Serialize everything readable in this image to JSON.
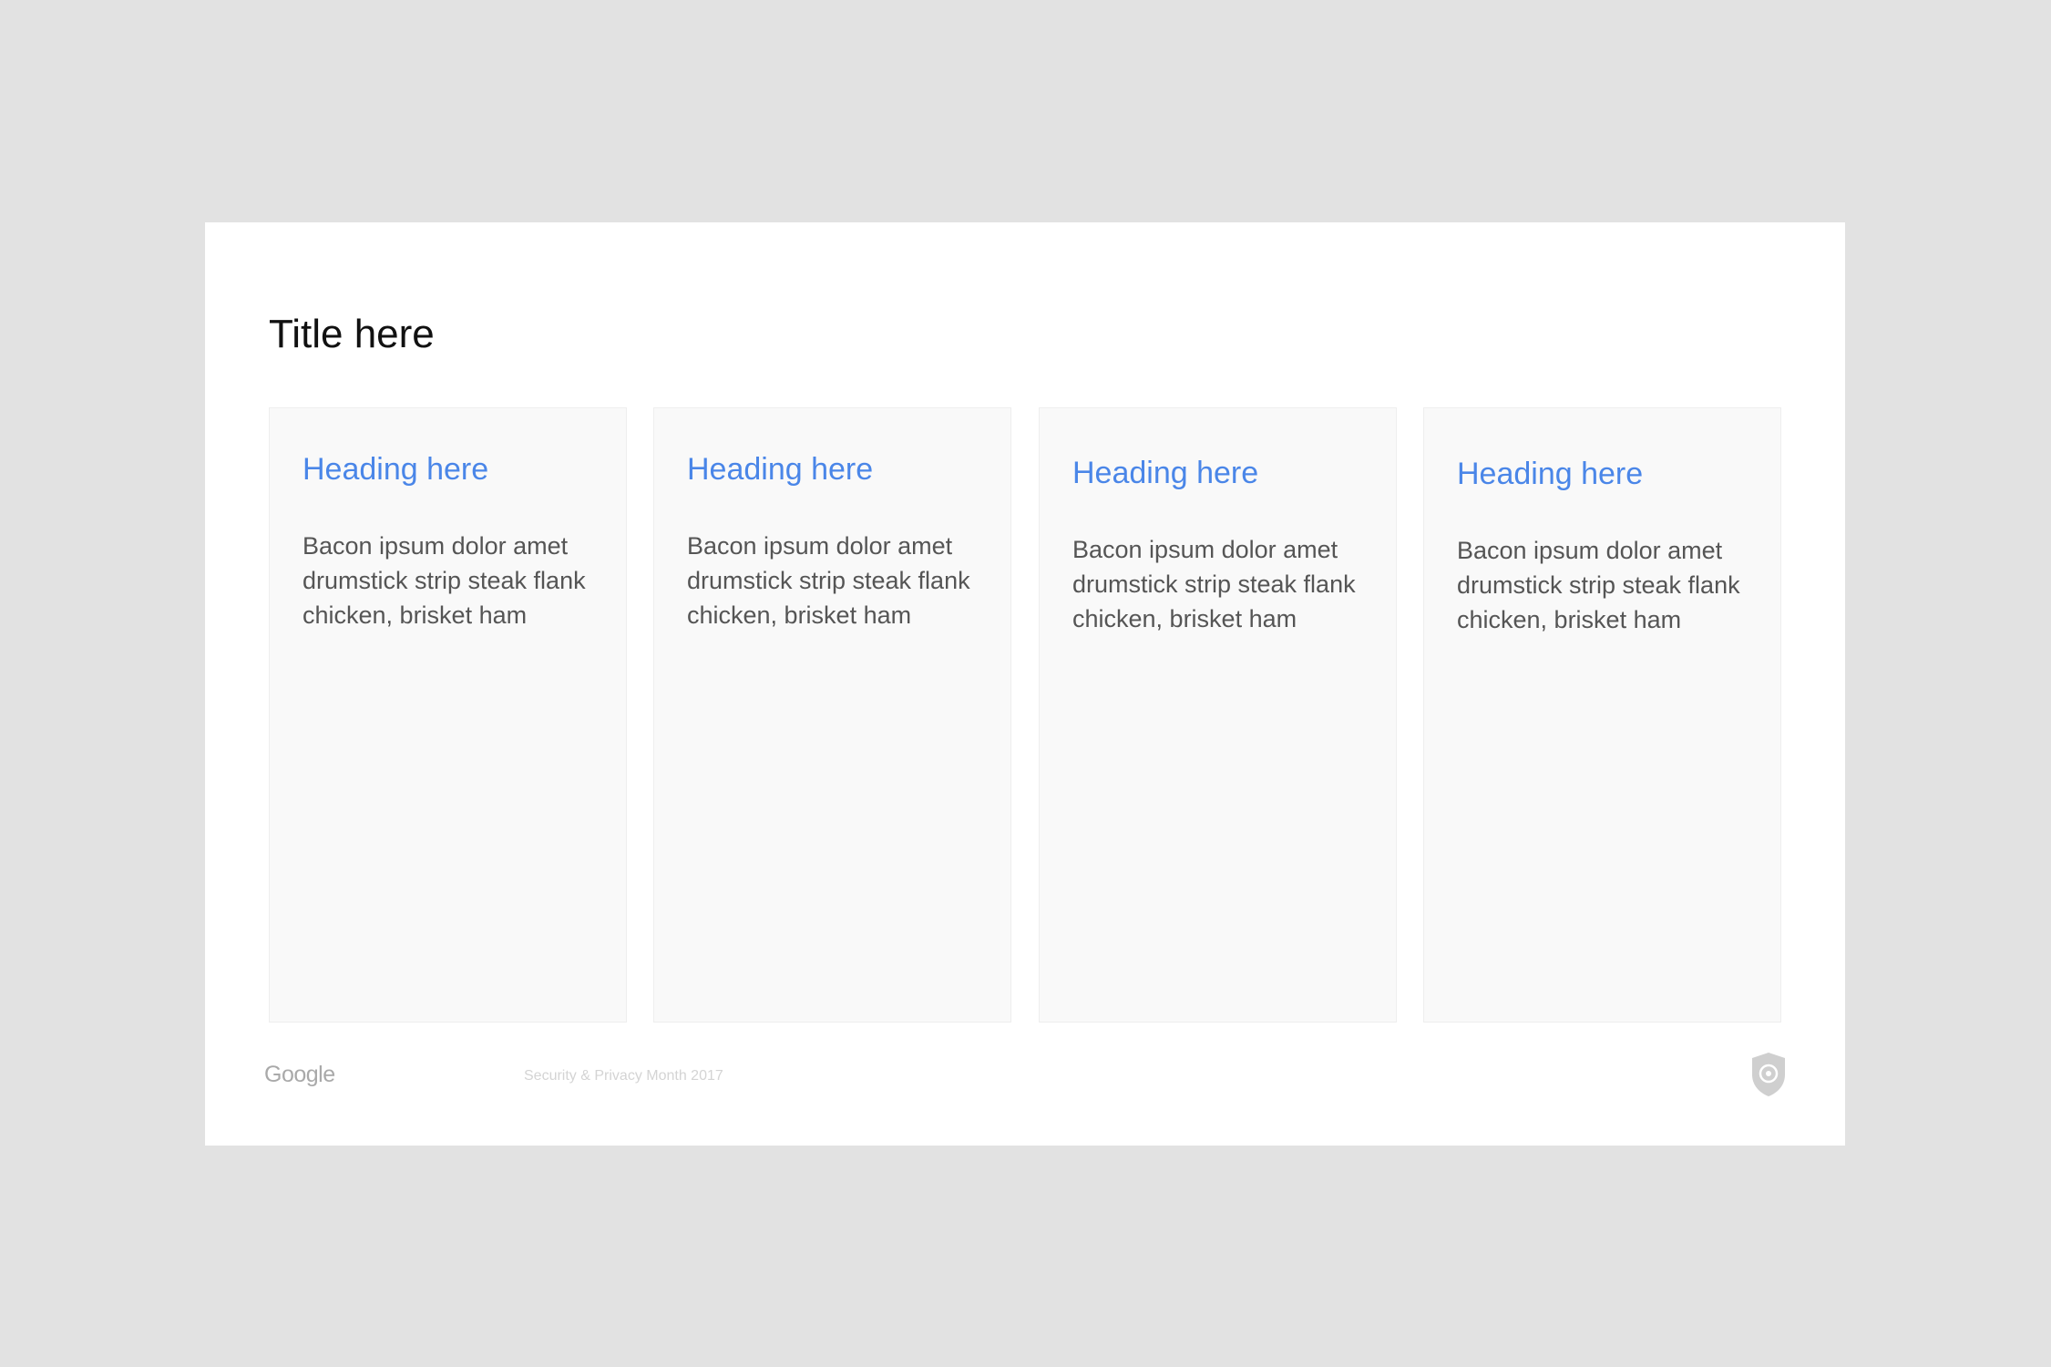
{
  "slide": {
    "title": "Title here",
    "cards": [
      {
        "heading": "Heading here",
        "body": "Bacon ipsum dolor amet drumstick strip steak flank chicken, brisket ham"
      },
      {
        "heading": "Heading here",
        "body": "Bacon ipsum dolor amet drumstick strip steak flank chicken, brisket ham"
      },
      {
        "heading": "Heading here",
        "body": "Bacon ipsum dolor amet drumstick strip steak flank chicken, brisket ham"
      },
      {
        "heading": "Heading here",
        "body": "Bacon ipsum dolor amet drumstick strip steak flank chicken, brisket ham"
      }
    ],
    "footer": {
      "logo": "Google",
      "event": "Security & Privacy Month 2017",
      "icon": "shield-icon"
    }
  },
  "colors": {
    "background": "#e2e2e2",
    "slide": "#ffffff",
    "card": "#f9f9f9",
    "heading": "#4a86e8",
    "body_text": "#555555",
    "footer_text": "#d4d4d4"
  }
}
